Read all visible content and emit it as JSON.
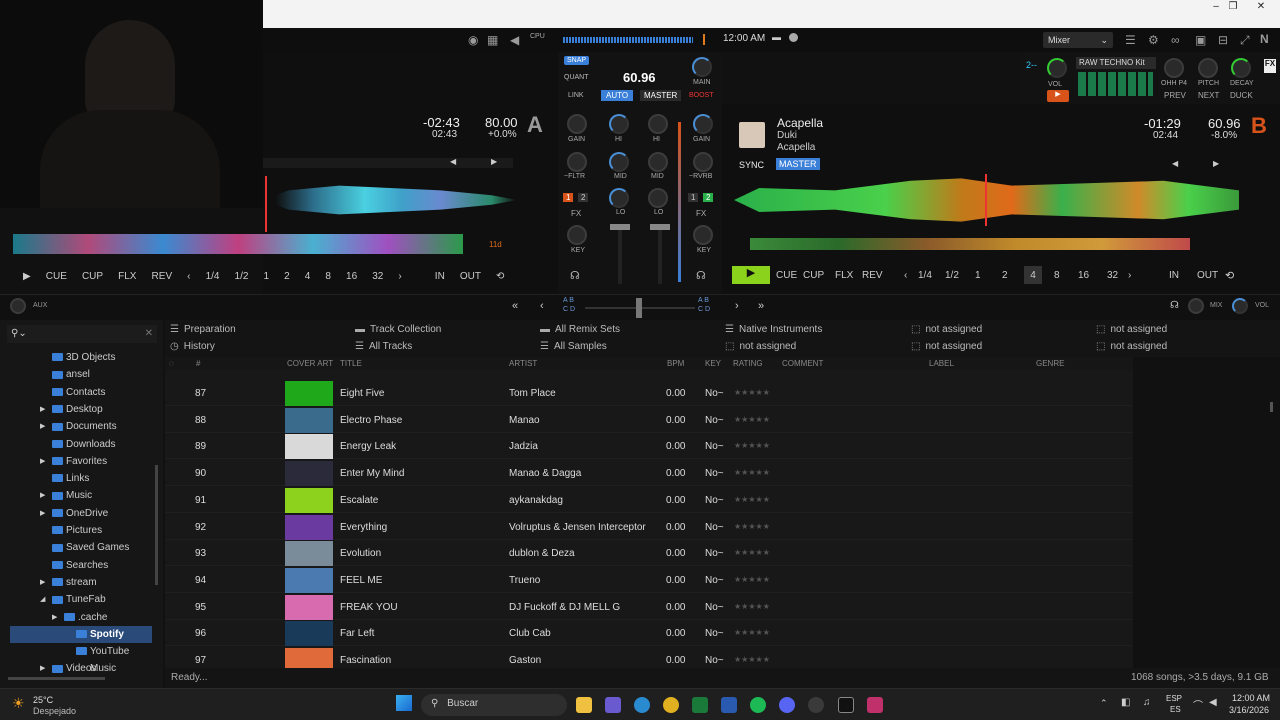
{
  "window": {
    "minimize": "–",
    "maximize": "❐",
    "close": "✕"
  },
  "topbar": {
    "cpu": "CPU",
    "time": "12:00 AM",
    "mixer_select": "Mixer"
  },
  "deckA": {
    "time_remaining": "-02:43",
    "time_total": "02:43",
    "bpm": "80.00",
    "pitch": "+0.0%",
    "letter": "A",
    "beat_marker": "11d",
    "buttons": {
      "cue": "CUE",
      "cup": "CUP",
      "flx": "FLX",
      "rev": "REV",
      "in": "IN",
      "out": "OUT"
    },
    "loops": [
      "1/4",
      "1/2",
      "1",
      "2",
      "4",
      "8",
      "16",
      "32"
    ]
  },
  "deckB": {
    "title": "Acapella",
    "artist": "Duki",
    "album": "Acapella",
    "time_remaining": "-01:29",
    "time_total": "02:44",
    "bpm": "60.96",
    "pitch": "-8.0%",
    "letter": "B",
    "sync": "SYNC",
    "master": "MASTER",
    "buttons": {
      "cue": "CUE",
      "cup": "CUP",
      "flx": "FLX",
      "rev": "REV",
      "in": "IN",
      "out": "OUT"
    },
    "loops": [
      "1/4",
      "1/2",
      "1",
      "2",
      "4",
      "8",
      "16",
      "32"
    ],
    "active_loop": "4"
  },
  "mixer": {
    "snap": "SNAP",
    "quant": "QUANT",
    "tempo": "60.96",
    "link": "LINK",
    "auto": "AUTO",
    "master": "MASTER",
    "main": "MAIN",
    "boost": "BOOST",
    "gain": "GAIN",
    "hi": "HI",
    "mid": "MID",
    "lo": "LO",
    "key": "KEY",
    "fltr": "~FLTR",
    "rvrb": "~RVRB",
    "fx": "FX",
    "fx1": "1",
    "fx2": "2"
  },
  "remix": {
    "deck_label": "2--",
    "vol": "VOL",
    "kit": "RAW TECHNO Kit",
    "ohh": "OHH P4",
    "pitch": "PITCH",
    "decay": "DECAY",
    "prev": "PREV",
    "next": "NEXT",
    "duck": "DUCK",
    "fx": "FX"
  },
  "fxbar": {
    "aux": "AUX",
    "mix": "MIX",
    "vol": "VOL",
    "ab": "A B",
    "cd": "C D"
  },
  "favorites": [
    {
      "label": "Preparation",
      "icon": "list-icon"
    },
    {
      "label": "Track Collection",
      "icon": "folder-icon"
    },
    {
      "label": "All Remix Sets",
      "icon": "folder-icon"
    },
    {
      "label": "Native Instruments",
      "icon": "list-icon"
    },
    {
      "label": "not assigned",
      "icon": "empty-slot-icon"
    },
    {
      "label": "not assigned",
      "icon": "empty-slot-icon"
    },
    {
      "label": "History",
      "icon": "history-icon"
    },
    {
      "label": "All Tracks",
      "icon": "list-icon"
    },
    {
      "label": "All Samples",
      "icon": "list-icon"
    },
    {
      "label": "not assigned",
      "icon": "empty-slot-icon"
    },
    {
      "label": "not assigned",
      "icon": "empty-slot-icon"
    },
    {
      "label": "not assigned",
      "icon": "empty-slot-icon"
    }
  ],
  "tree": [
    {
      "label": "3D Objects",
      "arrow": ""
    },
    {
      "label": "ansel",
      "arrow": ""
    },
    {
      "label": "Contacts",
      "arrow": ""
    },
    {
      "label": "Desktop",
      "arrow": "▶"
    },
    {
      "label": "Documents",
      "arrow": "▶"
    },
    {
      "label": "Downloads",
      "arrow": ""
    },
    {
      "label": "Favorites",
      "arrow": "▶"
    },
    {
      "label": "Links",
      "arrow": ""
    },
    {
      "label": "Music",
      "arrow": "▶"
    },
    {
      "label": "OneDrive",
      "arrow": "▶"
    },
    {
      "label": "Pictures",
      "arrow": ""
    },
    {
      "label": "Saved Games",
      "arrow": ""
    },
    {
      "label": "Searches",
      "arrow": ""
    },
    {
      "label": "stream",
      "arrow": "▶"
    },
    {
      "label": "TuneFab",
      "arrow": "◢"
    },
    {
      "label": ".cache",
      "arrow": "▶"
    },
    {
      "label": "Spotify",
      "arrow": ""
    },
    {
      "label": "YouTube Music",
      "arrow": ""
    },
    {
      "label": "Videos",
      "arrow": "▶"
    }
  ],
  "columns": {
    "num": "#",
    "cover": "COVER ART",
    "title": "TITLE",
    "artist": "ARTIST",
    "bpm": "BPM",
    "key": "KEY",
    "rating": "RATING",
    "comment": "COMMENT",
    "label": "LABEL",
    "genre": "GENRE"
  },
  "tracks": [
    {
      "num": "87",
      "title": "Eight Five",
      "artist": "Tom Place",
      "bpm": "0.00",
      "key": "No~",
      "rating": "★★★★★",
      "color": "#1fa81a"
    },
    {
      "num": "88",
      "title": "Electro Phase",
      "artist": "Manao",
      "bpm": "0.00",
      "key": "No~",
      "rating": "★★★★★",
      "color": "#3a6a8c"
    },
    {
      "num": "89",
      "title": "Energy Leak",
      "artist": "Jadzia",
      "bpm": "0.00",
      "key": "No~",
      "rating": "★★★★★",
      "color": "#d9d9d9"
    },
    {
      "num": "90",
      "title": "Enter My Mind",
      "artist": "Manao & Dagga",
      "bpm": "0.00",
      "key": "No~",
      "rating": "★★★★★",
      "color": "#2a2a3a"
    },
    {
      "num": "91",
      "title": "Escalate",
      "artist": "aykanakdag",
      "bpm": "0.00",
      "key": "No~",
      "rating": "★★★★★",
      "color": "#8dd21c"
    },
    {
      "num": "92",
      "title": "Everything",
      "artist": "Volruptus & Jensen Interceptor",
      "bpm": "0.00",
      "key": "No~",
      "rating": "★★★★★",
      "color": "#6a3aa0"
    },
    {
      "num": "93",
      "title": "Evolution",
      "artist": "dublon & Deza",
      "bpm": "0.00",
      "key": "No~",
      "rating": "★★★★★",
      "color": "#7a8c9a"
    },
    {
      "num": "94",
      "title": "FEEL ME",
      "artist": "Trueno",
      "bpm": "0.00",
      "key": "No~",
      "rating": "★★★★★",
      "color": "#4a7ab0"
    },
    {
      "num": "95",
      "title": "FREAK YOU",
      "artist": "DJ Fuckoff & DJ MELL G",
      "bpm": "0.00",
      "key": "No~",
      "rating": "★★★★★",
      "color": "#d86ab0"
    },
    {
      "num": "96",
      "title": "Far Left",
      "artist": "Club Cab",
      "bpm": "0.00",
      "key": "No~",
      "rating": "★★★★★",
      "color": "#1a3a5a"
    },
    {
      "num": "97",
      "title": "Fascination",
      "artist": "Gaston",
      "bpm": "0.00",
      "key": "No~",
      "rating": "★★★★★",
      "color": "#e06a3a"
    }
  ],
  "status": {
    "left": "Ready...",
    "right": "1068 songs, >3.5 days, 9.1 GB"
  },
  "taskbar": {
    "weather_temp": "25°C",
    "weather_desc": "Despejado",
    "search": "Buscar",
    "lang1": "ESP",
    "lang2": "ES",
    "clock_time": "12:00 AM",
    "clock_date": "3/16/2026"
  }
}
